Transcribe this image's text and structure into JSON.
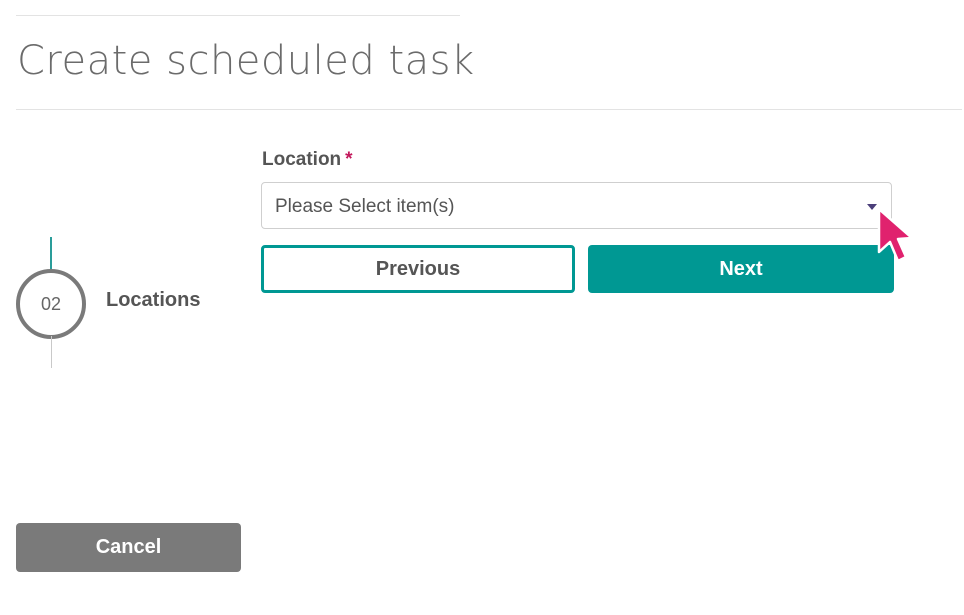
{
  "header": {
    "title": "Create scheduled task"
  },
  "stepper": {
    "step_number": "02",
    "step_label": "Locations"
  },
  "form": {
    "location_label": "Location",
    "required_marker": "*",
    "location_select": {
      "placeholder": "Please Select item(s)"
    }
  },
  "actions": {
    "previous_label": "Previous",
    "next_label": "Next",
    "cancel_label": "Cancel"
  },
  "colors": {
    "accent": "#009893",
    "required": "#c2185b",
    "cancel_bg": "#7a7a7a",
    "cursor": "#e0226e"
  },
  "icons": {
    "dropdown": "caret-down-icon",
    "cursor": "mouse-pointer-icon"
  }
}
